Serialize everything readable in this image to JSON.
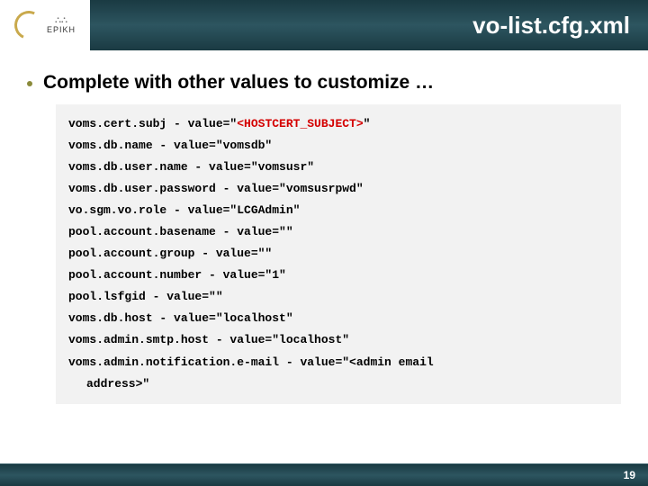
{
  "header": {
    "title": "vo-list.cfg.xml",
    "logo_name": "EPIKH"
  },
  "content": {
    "heading": "Complete with other values to customize …"
  },
  "code": {
    "lines": [
      {
        "prefix": "voms.cert.subj - value=\"",
        "red": "<HOSTCERT_SUBJECT>",
        "suffix": "\""
      },
      {
        "text": "voms.db.name - value=\"vomsdb\""
      },
      {
        "text": "voms.db.user.name - value=\"vomsusr\""
      },
      {
        "text": "voms.db.user.password - value=\"vomsusrpwd\""
      },
      {
        "text": "vo.sgm.vo.role - value=\"LCGAdmin\""
      },
      {
        "text": "pool.account.basename - value=\"\""
      },
      {
        "text": "pool.account.group - value=\"\""
      },
      {
        "text": "pool.account.number - value=\"1\""
      },
      {
        "text": "pool.lsfgid - value=\"\""
      },
      {
        "text": "voms.db.host - value=\"localhost\""
      },
      {
        "text": "voms.admin.smtp.host - value=\"localhost\""
      },
      {
        "text": "voms.admin.notification.e-mail - value=\"<admin email"
      },
      {
        "text": "address>\"",
        "indent": true
      }
    ]
  },
  "footer": {
    "page": "19"
  }
}
